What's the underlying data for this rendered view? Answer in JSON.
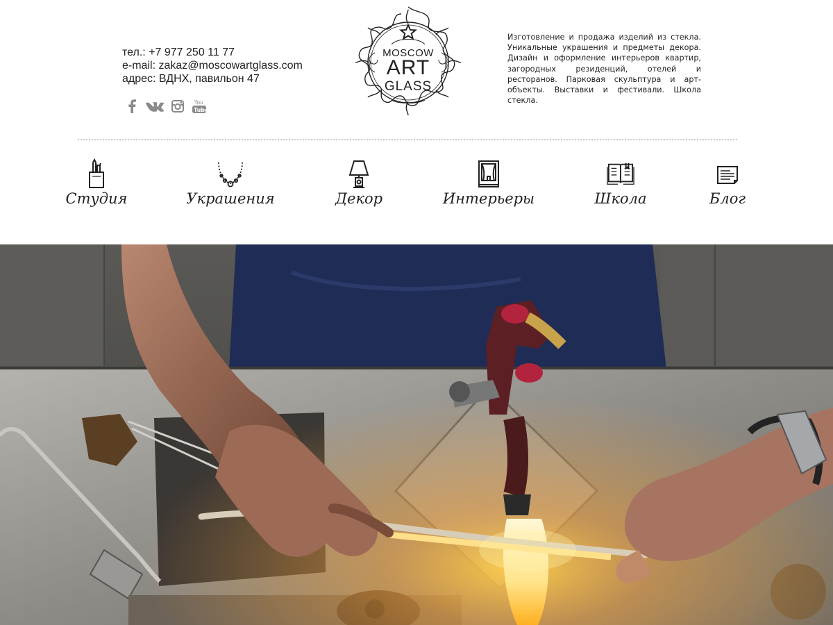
{
  "contacts": {
    "phone": "тел.: +7 977 250 11 77",
    "email": "e-mail: zakaz@moscowartglass.com",
    "address": "адрес: ВДНХ, павильон 47"
  },
  "socials": [
    {
      "icon": "facebook-icon"
    },
    {
      "icon": "vk-icon"
    },
    {
      "icon": "instagram-icon"
    },
    {
      "icon": "youtube-icon"
    }
  ],
  "logo": {
    "line1": "MOSCOW",
    "line2": "ART",
    "line3": "GLASS"
  },
  "about": "Изготовление и продажа изделий из стекла. Уникальные украшения и предметы декора. Дизайн и оформление интерьеров квартир, загородных резиденций, отелей и ресторанов. Парковая скульптура и арт-объекты. Выставки и фестивали. Школа стекла.",
  "nav": {
    "items": [
      {
        "label": "Студия",
        "icon": "brushes-cup-icon"
      },
      {
        "label": "Украшения",
        "icon": "necklace-icon"
      },
      {
        "label": "Декор",
        "icon": "lamp-icon"
      },
      {
        "label": "Интерьеры",
        "icon": "window-icon"
      },
      {
        "label": "Школа",
        "icon": "book-icon"
      },
      {
        "label": "Блог",
        "icon": "blog-icon"
      }
    ]
  },
  "colors": {
    "text": "#222222",
    "social": "#8a8a8a",
    "divider": "#c8c8c8",
    "flame": "#ffb020"
  }
}
